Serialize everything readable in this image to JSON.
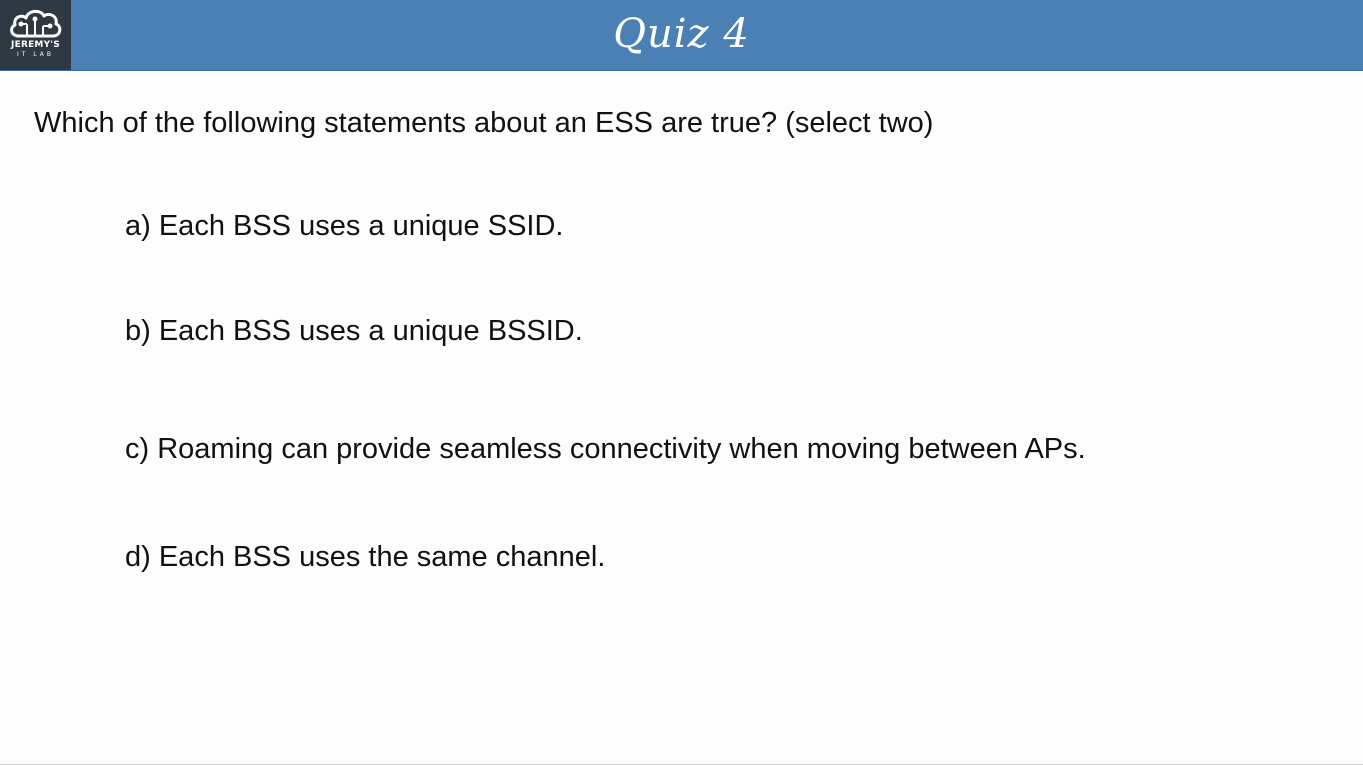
{
  "header": {
    "logo_line1": "JEREMY'S",
    "logo_line2": "IT LAB",
    "logo_icon": "cloud-circuit-icon",
    "title": "Quiz 4",
    "background_color": "#4a80b4",
    "logo_background_color": "#2e3943"
  },
  "quiz": {
    "question": "Which of the following statements about an ESS are true? (select two)",
    "options": [
      "a) Each BSS uses a unique SSID.",
      "b) Each BSS uses a unique BSSID.",
      "c) Roaming can provide seamless connectivity when moving between APs.",
      "d) Each BSS uses the same channel."
    ]
  }
}
